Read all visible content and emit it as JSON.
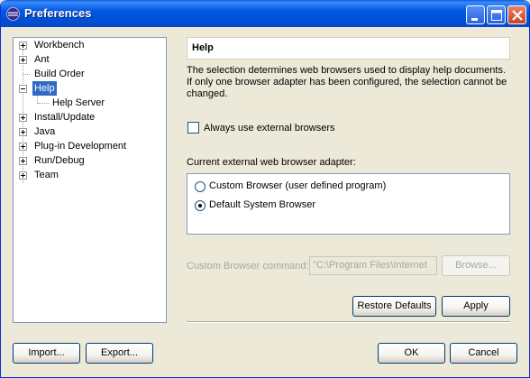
{
  "window": {
    "title": "Preferences"
  },
  "tree": {
    "items": [
      {
        "label": "Workbench",
        "expander": "plus"
      },
      {
        "label": "Ant",
        "expander": "plus"
      },
      {
        "label": "Build Order",
        "expander": "none"
      },
      {
        "label": "Help",
        "expander": "minus",
        "selected": true
      },
      {
        "label": "Help Server",
        "expander": "child"
      },
      {
        "label": "Install/Update",
        "expander": "plus"
      },
      {
        "label": "Java",
        "expander": "plus"
      },
      {
        "label": "Plug-in Development",
        "expander": "plus"
      },
      {
        "label": "Run/Debug",
        "expander": "plus"
      },
      {
        "label": "Team",
        "expander": "plus"
      }
    ]
  },
  "page": {
    "title": "Help",
    "description": "The selection determines web browsers used to display help documents. If only one browser adapter has been configured, the selection cannot be changed.",
    "always_external": {
      "label": "Always use external browsers",
      "checked": false
    },
    "adapter_label": "Current external web browser adapter:",
    "adapters": [
      {
        "label": "Custom Browser (user defined program)",
        "selected": false
      },
      {
        "label": "Default System Browser",
        "selected": true
      }
    ],
    "custom_command": {
      "label": "Custom Browser command:",
      "value": "\"C:\\Program Files\\Internet",
      "browse_label": "Browse..."
    },
    "restore_defaults_label": "Restore Defaults",
    "apply_label": "Apply"
  },
  "footer": {
    "import_label": "Import...",
    "export_label": "Export...",
    "ok_label": "OK",
    "cancel_label": "Cancel"
  }
}
